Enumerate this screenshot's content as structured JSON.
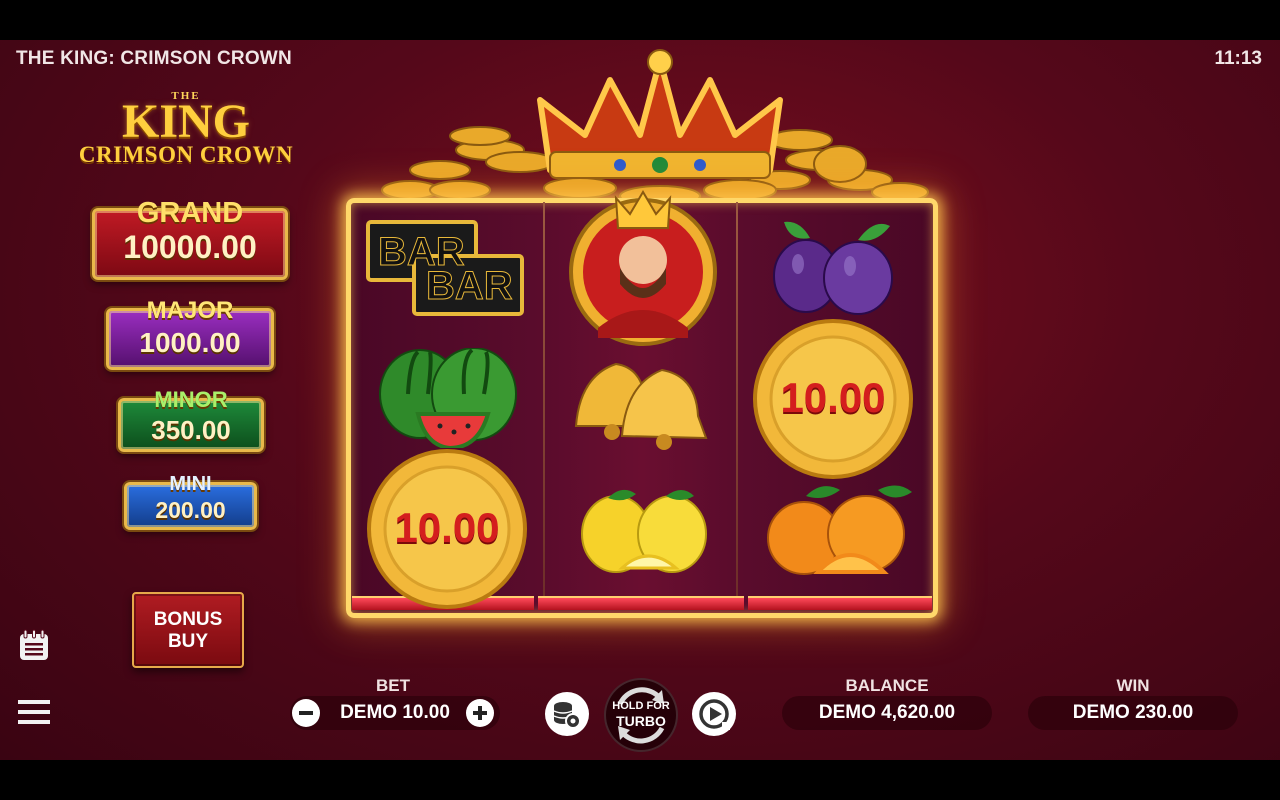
{
  "header": {
    "game_title": "THE KING: CRIMSON CROWN",
    "clock": "11:13"
  },
  "logo": {
    "the": "THE",
    "king": "KING",
    "subtitle": "CRIMSON CROWN"
  },
  "jackpots": {
    "grand": {
      "label": "GRAND",
      "value": "10000.00"
    },
    "major": {
      "label": "MAJOR",
      "value": "1000.00"
    },
    "minor": {
      "label": "MINOR",
      "value": "350.00"
    },
    "mini": {
      "label": "MINI",
      "value": "200.00"
    }
  },
  "bonus_buy": {
    "line1": "BONUS",
    "line2": "BUY"
  },
  "reels": {
    "reel1": [
      {
        "symbol": "bar-double",
        "text": "BAR"
      },
      {
        "symbol": "watermelon"
      },
      {
        "symbol": "coin",
        "value": "10.00"
      }
    ],
    "reel2": [
      {
        "symbol": "king"
      },
      {
        "symbol": "bells"
      },
      {
        "symbol": "lemons"
      }
    ],
    "reel3": [
      {
        "symbol": "plums"
      },
      {
        "symbol": "coin",
        "value": "10.00"
      },
      {
        "symbol": "oranges"
      }
    ]
  },
  "bottom_bar": {
    "bet_label": "BET",
    "bet_value": "DEMO 10.00",
    "turbo_line1": "HOLD FOR",
    "turbo_line2": "TURBO",
    "balance_label": "BALANCE",
    "balance_value": "DEMO 4,620.00",
    "win_label": "WIN",
    "win_value": "DEMO 230.00"
  },
  "icons": {
    "history": "notepad-icon",
    "menu": "hamburger-menu-icon",
    "bet_minus": "minus-icon",
    "bet_plus": "plus-icon",
    "coin_settings": "coin-stack-settings-icon",
    "spin": "spin-arrows-icon",
    "autoplay": "autoplay-icon"
  },
  "colors": {
    "background": "#55081a",
    "frame_glow": "#ffd86a",
    "gold": "#ffcf3e"
  }
}
